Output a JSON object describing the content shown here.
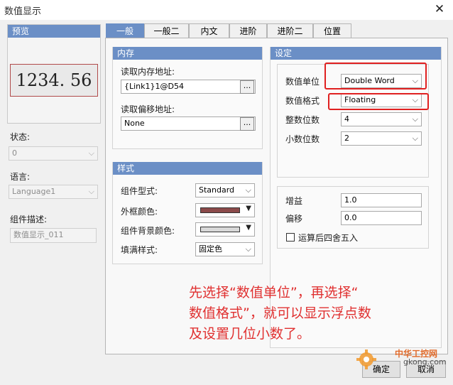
{
  "window": {
    "title": "数值显示",
    "close_glyph": "✕"
  },
  "preview": {
    "label": "预览",
    "display_value": "1234. 56"
  },
  "left": {
    "state_label": "状态:",
    "state_value": "0",
    "language_label": "语言:",
    "language_value": "Language1",
    "desc_label": "组件描述:",
    "desc_value": "数值显示_011"
  },
  "tabs": [
    "一般",
    "一般二",
    "内文",
    "进阶",
    "进阶二",
    "位置"
  ],
  "memory": {
    "header": "内存",
    "read_addr_label": "读取内存地址:",
    "read_addr_value": "{Link1}1@D54",
    "offset_label": "读取偏移地址:",
    "offset_value": "None",
    "browse_label": "..."
  },
  "style": {
    "header": "样式",
    "type_label": "组件型式:",
    "type_value": "Standard",
    "border_color_label": "外框颜色:",
    "bg_color_label": "组件背景颜色:",
    "fill_label": "填满样式:",
    "fill_value": "固定色",
    "border_color_hex": "#8b4a4a",
    "bg_color_hex": "#d8d8d8"
  },
  "settings": {
    "header": "设定",
    "unit_label": "数值单位",
    "unit_value": "Double Word",
    "format_label": "数值格式",
    "format_value": "Floating",
    "int_digits_label": "整数位数",
    "int_digits_value": "4",
    "dec_digits_label": "小数位数",
    "dec_digits_value": "2",
    "gain_label": "增益",
    "gain_value": "1.0",
    "offset_label": "偏移",
    "offset_value": "0.0",
    "round_label": "运算后四舍五入"
  },
  "annotation": {
    "lines": [
      "先选择“数值单位”，再选择“",
      "数值格式”，就可以显示浮点数",
      "及设置几位小数了。"
    ]
  },
  "buttons": {
    "ok": "确定",
    "cancel": "取消"
  },
  "watermark": {
    "text": "中华工控网",
    "url": "gkong.com"
  }
}
